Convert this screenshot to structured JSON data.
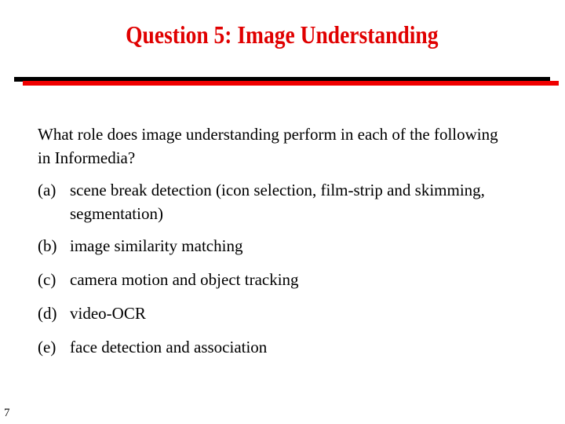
{
  "slide": {
    "title": "Question 5: Image Understanding",
    "question": "What role does image understanding perform in each of the following in Informedia?",
    "items": [
      {
        "label": "(a)",
        "text": "scene break detection (icon selection, film-strip and skimming, segmentation)"
      },
      {
        "label": "(b)",
        "text": "image similarity matching"
      },
      {
        "label": "(c)",
        "text": "camera motion and object tracking"
      },
      {
        "label": "(d)",
        "text": "video-OCR"
      },
      {
        "label": "(e)",
        "text": "face detection and association"
      }
    ],
    "page_number": "7",
    "colors": {
      "title": "#e00000",
      "rule_black": "#000000",
      "rule_red": "#f00000"
    }
  }
}
